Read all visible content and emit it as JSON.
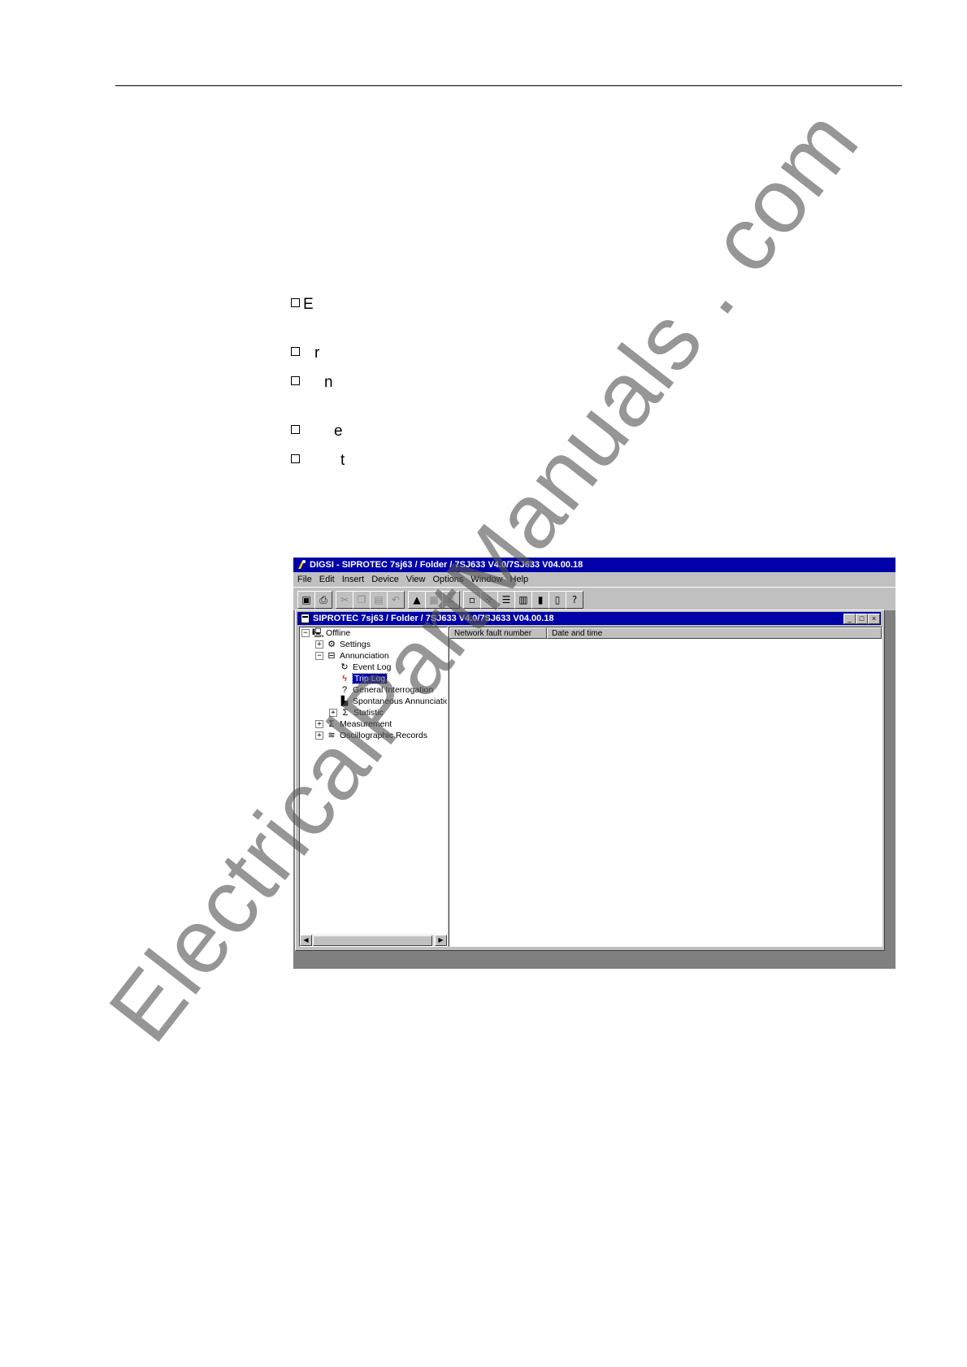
{
  "bullets": [
    "E",
    "r",
    "n",
    "e",
    "t"
  ],
  "app": {
    "title": "DIGSI - SIPROTEC 7sj63 / Folder / 7SJ633 V4.0/7SJ633 V04.00.18",
    "menu": [
      "File",
      "Edit",
      "Insert",
      "Device",
      "View",
      "Options",
      "Window",
      "Help"
    ]
  },
  "child_window": {
    "title": "SIPROTEC 7sj63 / Folder / 7SJ633 V4.0/7SJ633 V04.00.18",
    "minimize": "_",
    "maximize": "□",
    "close": "×"
  },
  "tree": {
    "root": "Offline",
    "settings": "Settings",
    "annunciation": "Annunciation",
    "event_log": "Event Log",
    "trip_log": "Trip Log",
    "general_interrogation": "General Interrogation",
    "spontaneous": "Spontaneous Annunciation",
    "statistic": "Statistic",
    "measurement": "Measurement",
    "oscillographic": "Oscillographic Records"
  },
  "list": {
    "columns": [
      "Network fault number",
      "Date and time"
    ]
  },
  "watermark": "ElectricalPartManuals . com",
  "colors": {
    "titlebar": "#0000a8",
    "face": "#c0c0c0",
    "desktop": "#808080"
  }
}
